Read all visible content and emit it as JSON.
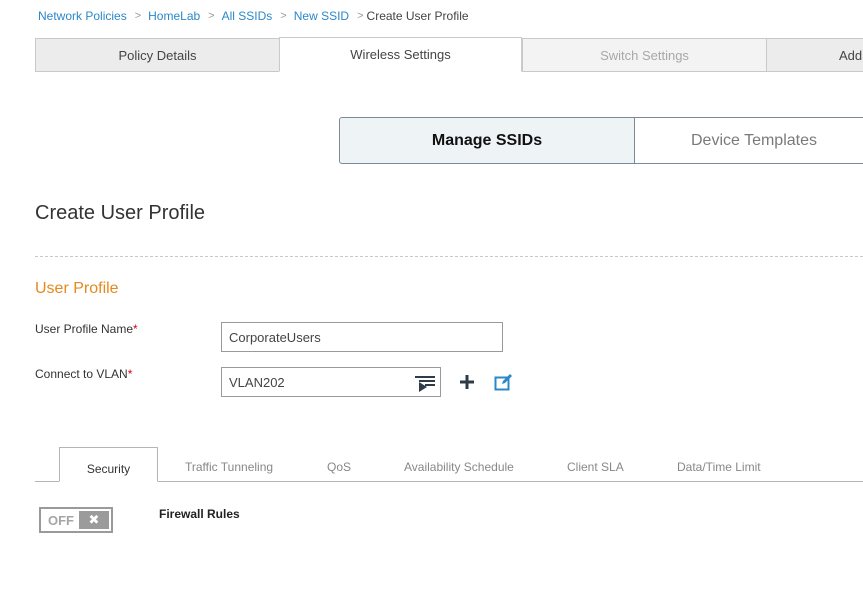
{
  "breadcrumb": {
    "items": [
      "Network Policies",
      "HomeLab",
      "All SSIDs",
      "New SSID"
    ],
    "current": "Create User Profile",
    "separator": ">"
  },
  "top_tabs": [
    "Policy Details",
    "Wireless Settings",
    "Switch Settings",
    "Addi"
  ],
  "segmented": {
    "active": "Manage SSIDs",
    "inactive": "Device Templates"
  },
  "page_title": "Create User Profile",
  "section_title": "User Profile",
  "form": {
    "profile_name_label": "User Profile Name",
    "profile_name_value": "CorporateUsers",
    "vlan_label": "Connect to VLAN",
    "vlan_value": "VLAN202",
    "required_marker": "*"
  },
  "sub_tabs": [
    "Security",
    "Traffic Tunneling",
    "QoS",
    "Availability Schedule",
    "Client SLA",
    "Data/Time Limit"
  ],
  "firewall": {
    "toggle_state": "OFF",
    "toggle_x": "✖",
    "label": "Firewall Rules"
  },
  "colors": {
    "link": "#2b88c8",
    "accent": "#e58a1e",
    "required": "#d0021b",
    "icon": "#2b88c8"
  }
}
